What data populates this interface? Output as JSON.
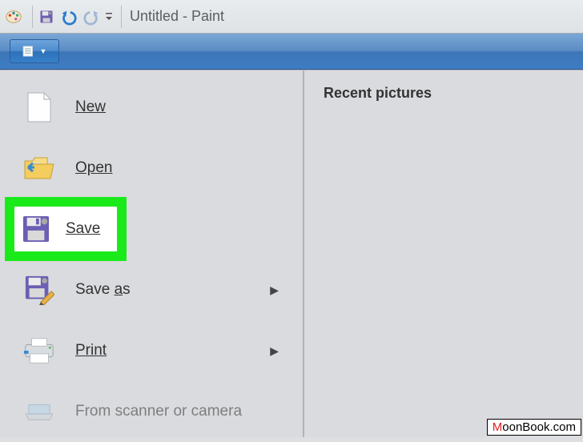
{
  "titlebar": {
    "title": "Untitled - Paint"
  },
  "menu": {
    "new": "New",
    "open": "Open",
    "save": "Save",
    "save_as": "Save as",
    "print": "Print",
    "from_scanner": "From scanner or camera"
  },
  "recent": {
    "heading": "Recent pictures"
  },
  "watermark": {
    "prefix": "M",
    "rest": "oonBook.com"
  }
}
